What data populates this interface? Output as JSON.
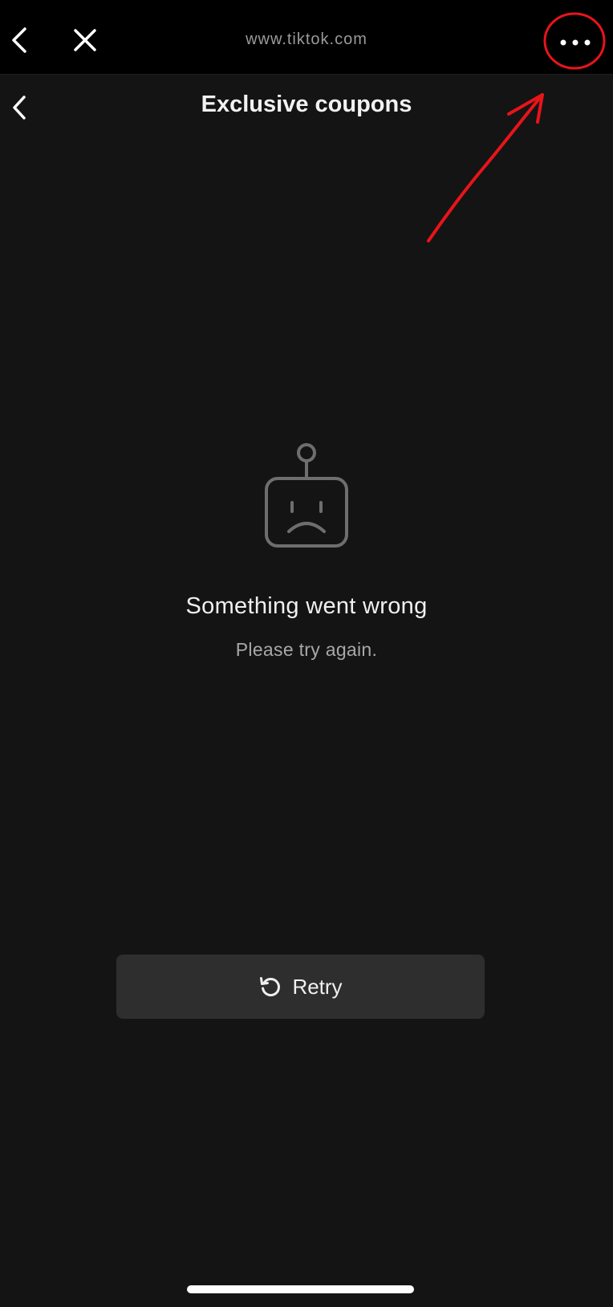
{
  "browser": {
    "url": "www.tiktok.com",
    "back_icon": "chevron-left-icon",
    "close_icon": "close-icon",
    "more_icon": "more-horizontal-icon"
  },
  "header": {
    "title": "Exclusive coupons",
    "back_icon": "chevron-left-icon"
  },
  "error": {
    "icon": "sad-robot-icon",
    "title": "Something went wrong",
    "subtitle": "Please try again."
  },
  "retry_button": {
    "label": "Retry",
    "icon": "refresh-icon"
  },
  "annotation": {
    "color": "#e8141a"
  },
  "colors": {
    "background": "#141414",
    "browser_bar": "#000000",
    "button": "#2e2e2e",
    "icon_gray": "#6e6e6e"
  }
}
